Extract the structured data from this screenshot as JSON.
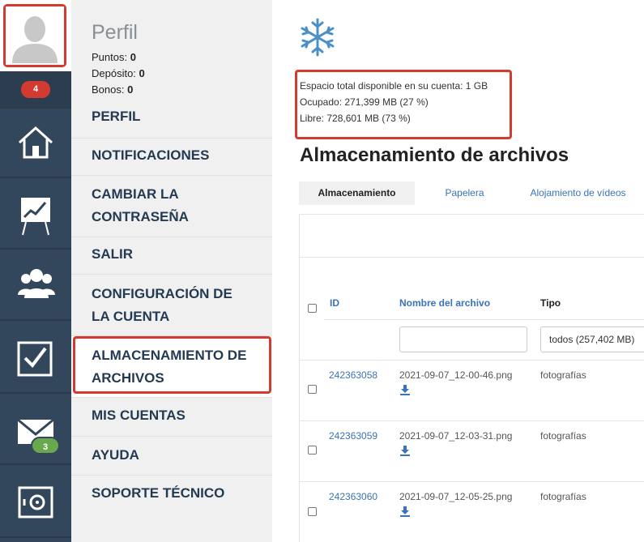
{
  "notifications_badge": "4",
  "mail_badge": "3",
  "profile": {
    "title": "Perfil",
    "stats": [
      {
        "label": "Puntos:",
        "value": "0"
      },
      {
        "label": "Depósito:",
        "value": "0"
      },
      {
        "label": "Bonos:",
        "value": "0"
      }
    ]
  },
  "menu": [
    {
      "label": "PERFIL"
    },
    {
      "label": "NOTIFICACIONES"
    },
    {
      "label": "CAMBIAR LA",
      "label2": "CONTRASEÑA"
    },
    {
      "label": "SALIR"
    },
    {
      "label": "CONFIGURACIÓN DE",
      "label2": "LA CUENTA"
    },
    {
      "label": "ALMACENAMIENTO DE",
      "label2": "ARCHIVOS"
    },
    {
      "label": "MIS CUENTAS"
    },
    {
      "label": "AYUDA"
    },
    {
      "label": "SOPORTE TÉCNICO"
    }
  ],
  "storage": {
    "total": "Espacio total disponible en su cuenta: 1 GB",
    "used": "Ocupado: 271,399 MB (27 %)",
    "free": "Libre: 728,601 MB (73 %)"
  },
  "page_title": "Almacenamiento de archivos",
  "tabs": [
    "Almacenamiento",
    "Papelera",
    "Alojamiento de vídeos"
  ],
  "columns": {
    "id": "ID",
    "name": "Nombre del archivo",
    "type": "Tipo"
  },
  "filters": {
    "name": "",
    "type": "todos (257,402 MB)"
  },
  "rows": [
    {
      "id": "242363058",
      "name": "2021-09-07_12-00-46.png",
      "type": "fotografías"
    },
    {
      "id": "242363059",
      "name": "2021-09-07_12-03-31.png",
      "type": "fotografías"
    },
    {
      "id": "242363060",
      "name": "2021-09-07_12-05-25.png",
      "type": "fotografías"
    }
  ],
  "colors": {
    "sidebar": "#33475c",
    "accent_red": "#d33b32",
    "link_blue": "#3a73b7",
    "badge_green": "#6aa84f"
  },
  "icons": [
    "user-avatar-icon",
    "home-icon",
    "chart-icon",
    "group-icon",
    "checkbox-icon",
    "mail-icon",
    "safe-icon",
    "snowflake-icon",
    "download-icon"
  ]
}
